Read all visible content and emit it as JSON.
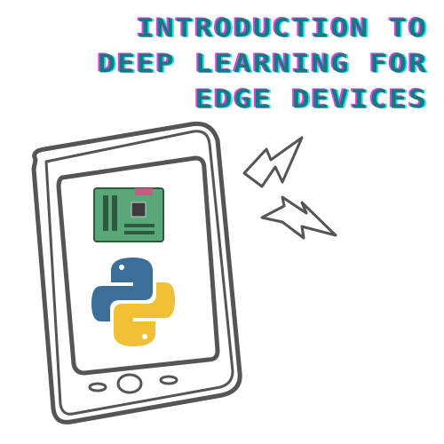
{
  "title": {
    "lines": [
      "Introduction to",
      "Deep Learning for",
      "Edge Devices"
    ]
  },
  "colors": {
    "title": "#137a7f",
    "shadow_magenta": "#e040e0",
    "shadow_cyan": "#20e8f0",
    "python_blue": "#3b6e99",
    "python_yellow": "#f2c035",
    "board_green": "#5aa87a",
    "sketch": "#555555"
  },
  "icons": [
    "phone-sketch",
    "motherboard-icon",
    "python-logo-icon",
    "lightning-icon"
  ]
}
